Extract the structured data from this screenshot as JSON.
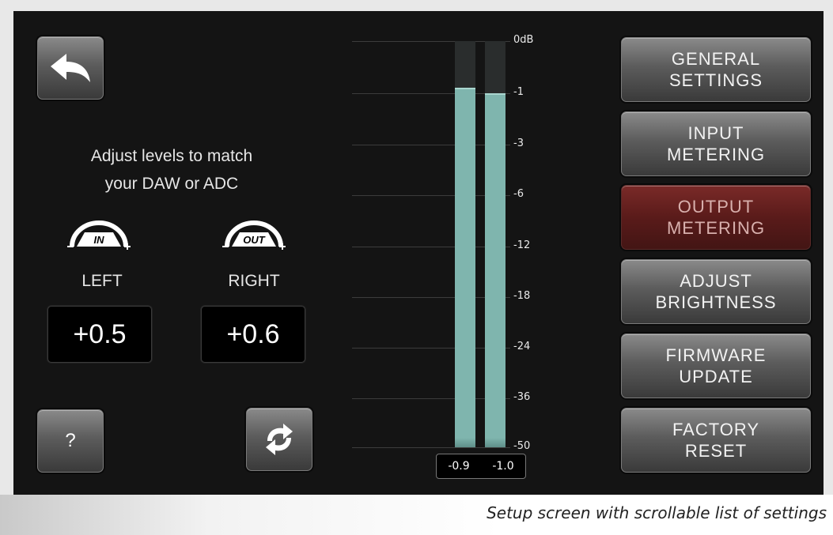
{
  "instructions": {
    "line1": "Adjust levels to match",
    "line2": "your DAW or ADC"
  },
  "trims": {
    "in_badge": "IN",
    "out_badge": "OUT",
    "left_label": "LEFT",
    "right_label": "RIGHT",
    "left_value": "+0.5",
    "right_value": "+0.6"
  },
  "buttons": {
    "back_icon": "back-arrow-icon",
    "help_label": "?",
    "refresh_icon": "refresh-icon"
  },
  "meter": {
    "scale": [
      "0dB",
      "-1",
      "-3",
      "-6",
      "-12",
      "-18",
      "-24",
      "-36",
      "-50"
    ],
    "left_peak_db": -0.9,
    "right_peak_db": -1.0,
    "readout_left": "-0.9",
    "readout_right": "-1.0",
    "fill_color": "#7fb5ae"
  },
  "menu": [
    {
      "line1": "GENERAL",
      "line2": "SETTINGS",
      "active": false
    },
    {
      "line1": "INPUT",
      "line2": "METERING",
      "active": false
    },
    {
      "line1": "OUTPUT",
      "line2": "METERING",
      "active": true
    },
    {
      "line1": "ADJUST",
      "line2": "BRIGHTNESS",
      "active": false
    },
    {
      "line1": "FIRMWARE",
      "line2": "UPDATE",
      "active": false
    },
    {
      "line1": "FACTORY",
      "line2": "RESET",
      "active": false
    }
  ],
  "caption": "Setup screen with scrollable list of settings",
  "colors": {
    "active_menu": "#5a1b1a",
    "meter": "#7fb5ae",
    "background": "#141414"
  }
}
